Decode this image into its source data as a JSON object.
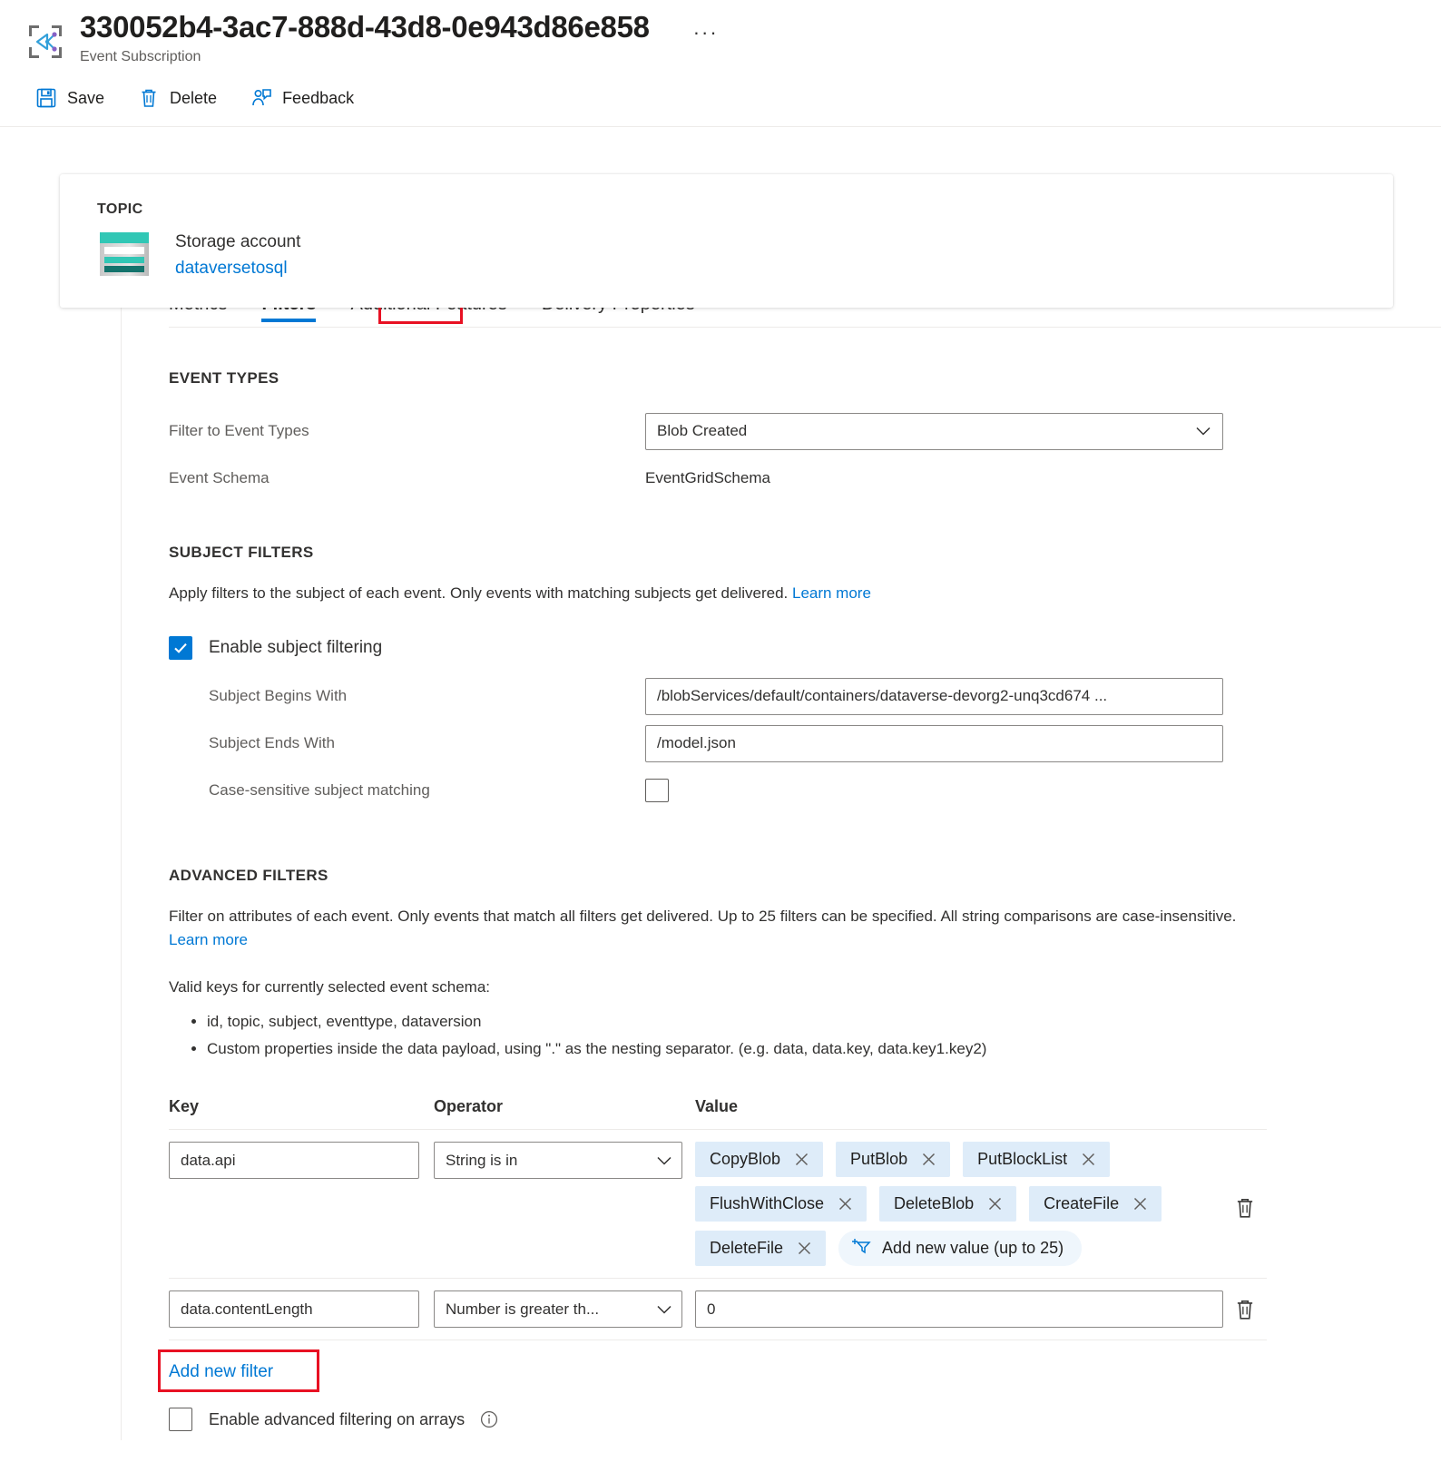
{
  "header": {
    "title": "330052b4-3ac7-888d-43d8-0e943d86e858",
    "subtitle": "Event Subscription",
    "more_label": "···",
    "resource_icon": "event-subscription-icon"
  },
  "commandbar": {
    "items": [
      {
        "label": "Save",
        "icon": "save-icon"
      },
      {
        "label": "Delete",
        "icon": "trash-icon"
      },
      {
        "label": "Feedback",
        "icon": "feedback-person-icon"
      }
    ]
  },
  "topic": {
    "label": "TOPIC",
    "icon": "storage-account-icon",
    "resource_type": "Storage account",
    "resource_name": "dataversetosql"
  },
  "tabs": {
    "items": [
      {
        "label": "Metrics",
        "selected": false
      },
      {
        "label": "Filters",
        "selected": true
      },
      {
        "label": "Additional Features",
        "selected": false
      },
      {
        "label": "Delivery Properties",
        "selected": false
      }
    ],
    "highlight_color": "#e81123",
    "accent_color": "#0078d4"
  },
  "event_types": {
    "section_title": "EVENT TYPES",
    "filter_label": "Filter to Event Types",
    "filter_value": "Blob Created",
    "schema_label": "Event Schema",
    "schema_value": "EventGridSchema"
  },
  "subject_filters": {
    "section_title": "SUBJECT FILTERS",
    "description": "Apply filters to the subject of each event. Only events with matching subjects get delivered.",
    "learn_more": "Learn more",
    "enable_label": "Enable subject filtering",
    "enable_checked": true,
    "begins_with_label": "Subject Begins With",
    "begins_with_value": "/blobServices/default/containers/dataverse-devorg2-unq3cd674 ...",
    "ends_with_label": "Subject Ends With",
    "ends_with_value": "/model.json",
    "case_sensitive_label": "Case-sensitive subject matching",
    "case_sensitive_checked": false
  },
  "advanced_filters": {
    "section_title": "ADVANCED FILTERS",
    "description": "Filter on attributes of each event. Only events that match all filters get delivered. Up to 25 filters can be specified. All string comparisons are case-insensitive.",
    "learn_more": "Learn more",
    "valid_keys_title": "Valid keys for currently selected event schema:",
    "valid_keys": [
      "id, topic, subject, eventtype, dataversion",
      "Custom properties inside the data payload, using \".\" as the nesting separator. (e.g. data, data.key, data.key1.key2)"
    ],
    "columns": {
      "key": "Key",
      "operator": "Operator",
      "value": "Value"
    },
    "rows": [
      {
        "key": "data.api",
        "operator": "String is in",
        "value_type": "chips",
        "chips": [
          "CopyBlob",
          "PutBlob",
          "PutBlockList",
          "FlushWithClose",
          "DeleteBlob",
          "CreateFile",
          "DeleteFile"
        ],
        "add_value_label": "Add new value (up to 25)",
        "add_value_icon": "filter-plus-icon",
        "delete_icon": "trash-icon"
      },
      {
        "key": "data.contentLength",
        "operator": "Number is greater th...",
        "value_type": "text",
        "value": "0",
        "delete_icon": "trash-icon"
      }
    ],
    "add_new_filter_label": "Add new filter",
    "arrays_label": "Enable advanced filtering on arrays",
    "arrays_checked": false,
    "arrays_info_icon": "info-icon"
  }
}
